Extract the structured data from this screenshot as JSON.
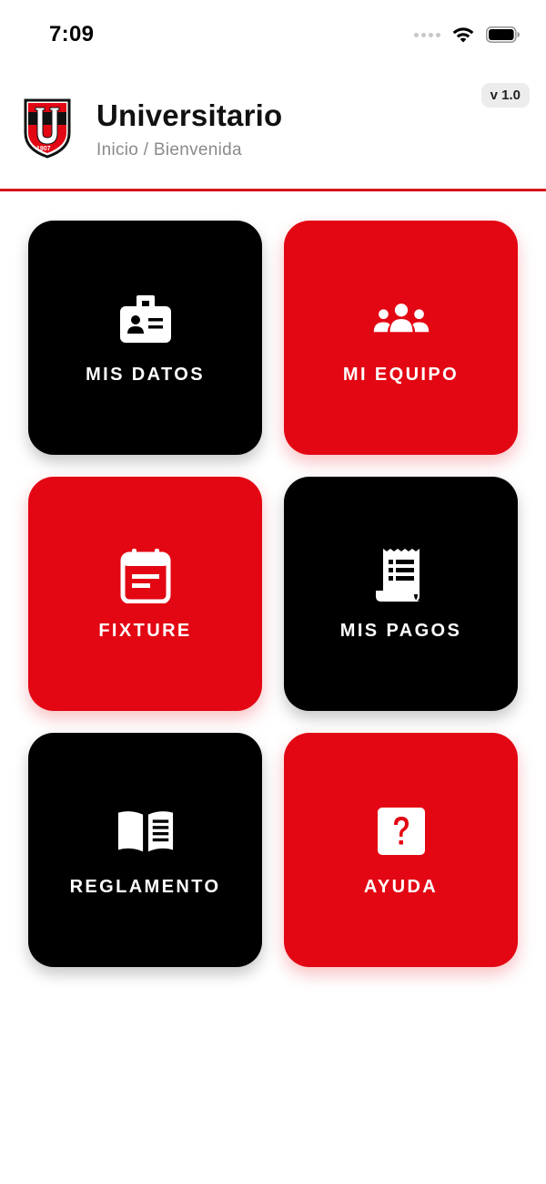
{
  "status_bar": {
    "time": "7:09",
    "icons": [
      "signal-icon",
      "wifi-icon",
      "battery-icon"
    ]
  },
  "header": {
    "title": "Universitario",
    "breadcrumb": "Inicio / Bienvenida",
    "version": "v 1.0",
    "logo": {
      "year": "1907",
      "letter": "U"
    }
  },
  "colors": {
    "brand_red": "#e30613",
    "divider_red": "#d6141c",
    "tile_black": "#000000"
  },
  "menu": {
    "tiles": [
      {
        "label": "MIS DATOS",
        "icon": "id-badge-icon",
        "color": "black"
      },
      {
        "label": "MI EQUIPO",
        "icon": "team-icon",
        "color": "red"
      },
      {
        "label": "FIXTURE",
        "icon": "calendar-icon",
        "color": "red"
      },
      {
        "label": "MIS PAGOS",
        "icon": "receipt-icon",
        "color": "black"
      },
      {
        "label": "REGLAMENTO",
        "icon": "book-icon",
        "color": "black"
      },
      {
        "label": "AYUDA",
        "icon": "help-icon",
        "color": "red"
      }
    ]
  }
}
